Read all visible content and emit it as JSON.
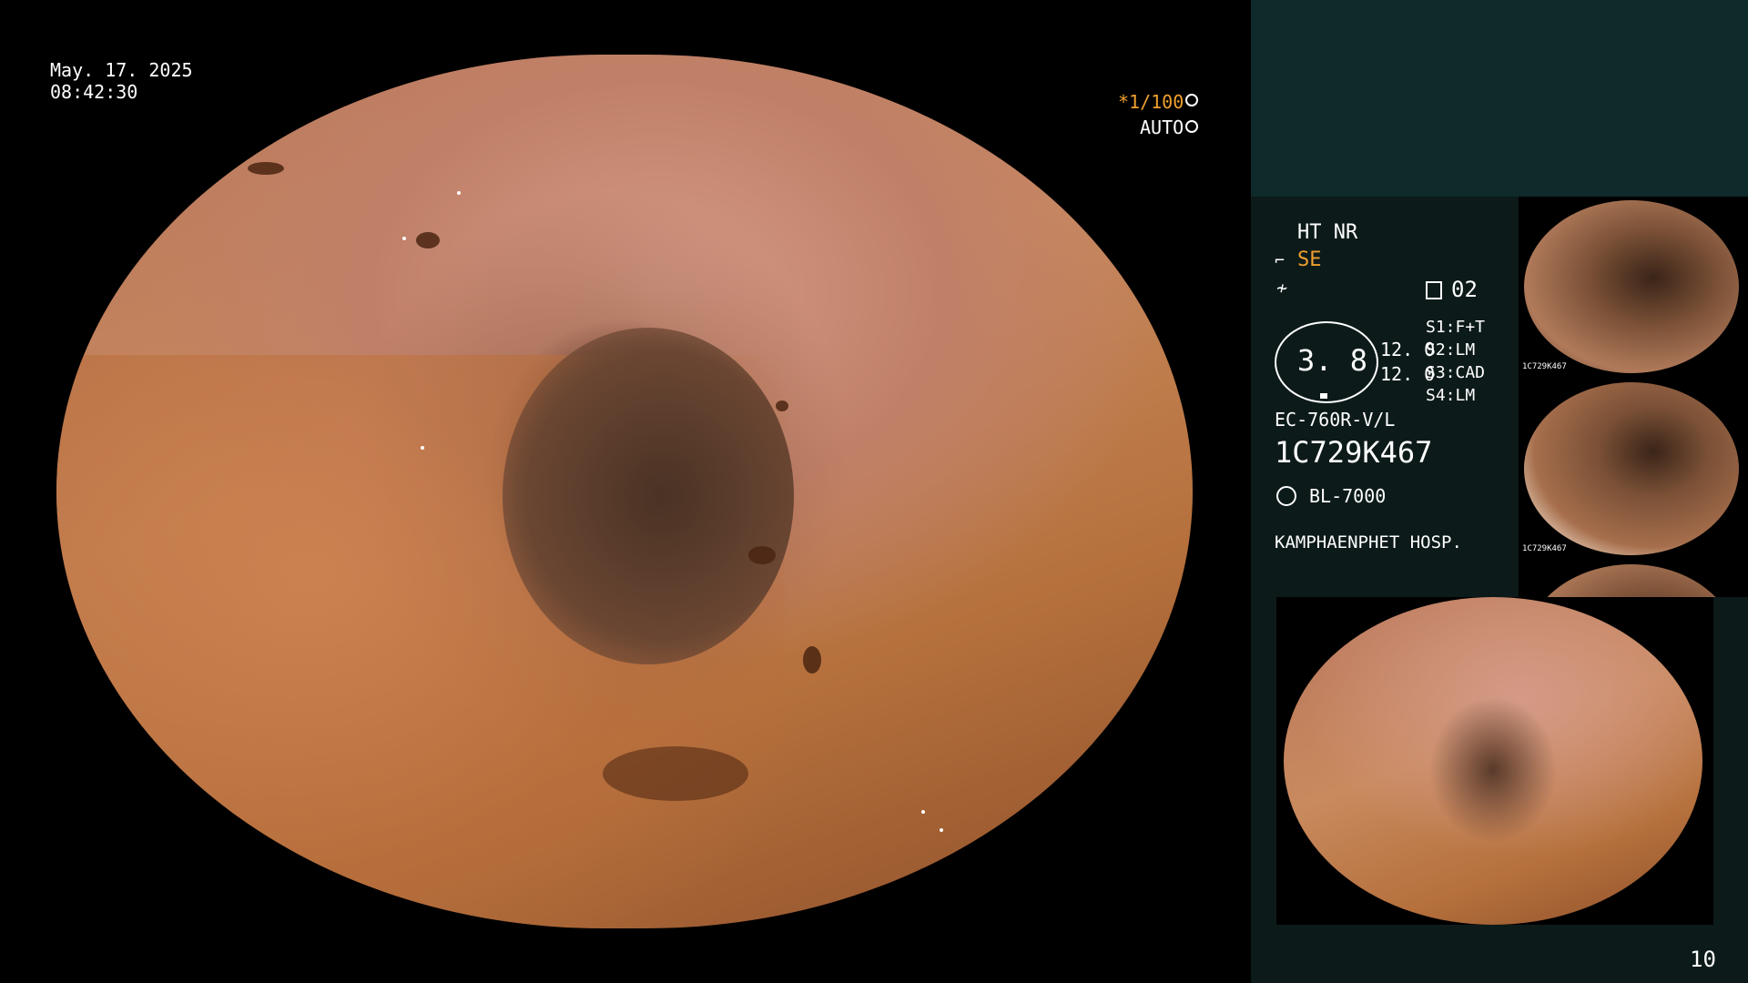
{
  "overlay": {
    "date": "May. 17. 2025",
    "time": "08:42:30",
    "shutter": "*1/100",
    "auto": "AUTO"
  },
  "panel": {
    "mode": "HT NR",
    "se": "SE",
    "counter": "02",
    "circle_value": "3. 8",
    "val1": "12. 0",
    "val2": "12. 0",
    "s1": "S1:F+T",
    "s2": "S2:LM",
    "s3": "S3:CAD",
    "s4": "S4:LM",
    "scope_model": "EC-760R-V/L",
    "scope_serial": "1C729K467",
    "light_source": "BL-7000",
    "hospital": "KAMPHAENPHET HOSP.",
    "page_number": "10"
  },
  "thumbs": {
    "t1_label": "1C729K467",
    "t2_label": "1C729K467"
  },
  "colors": {
    "accent_orange": "#f0a030",
    "panel_bg": "#0d1a1a",
    "panel_top_bg": "#0e2a2a"
  },
  "icons": [
    "shutter-icon",
    "auto-icon",
    "enhance-icon",
    "fn-icon",
    "memory-icon",
    "light-icon"
  ]
}
